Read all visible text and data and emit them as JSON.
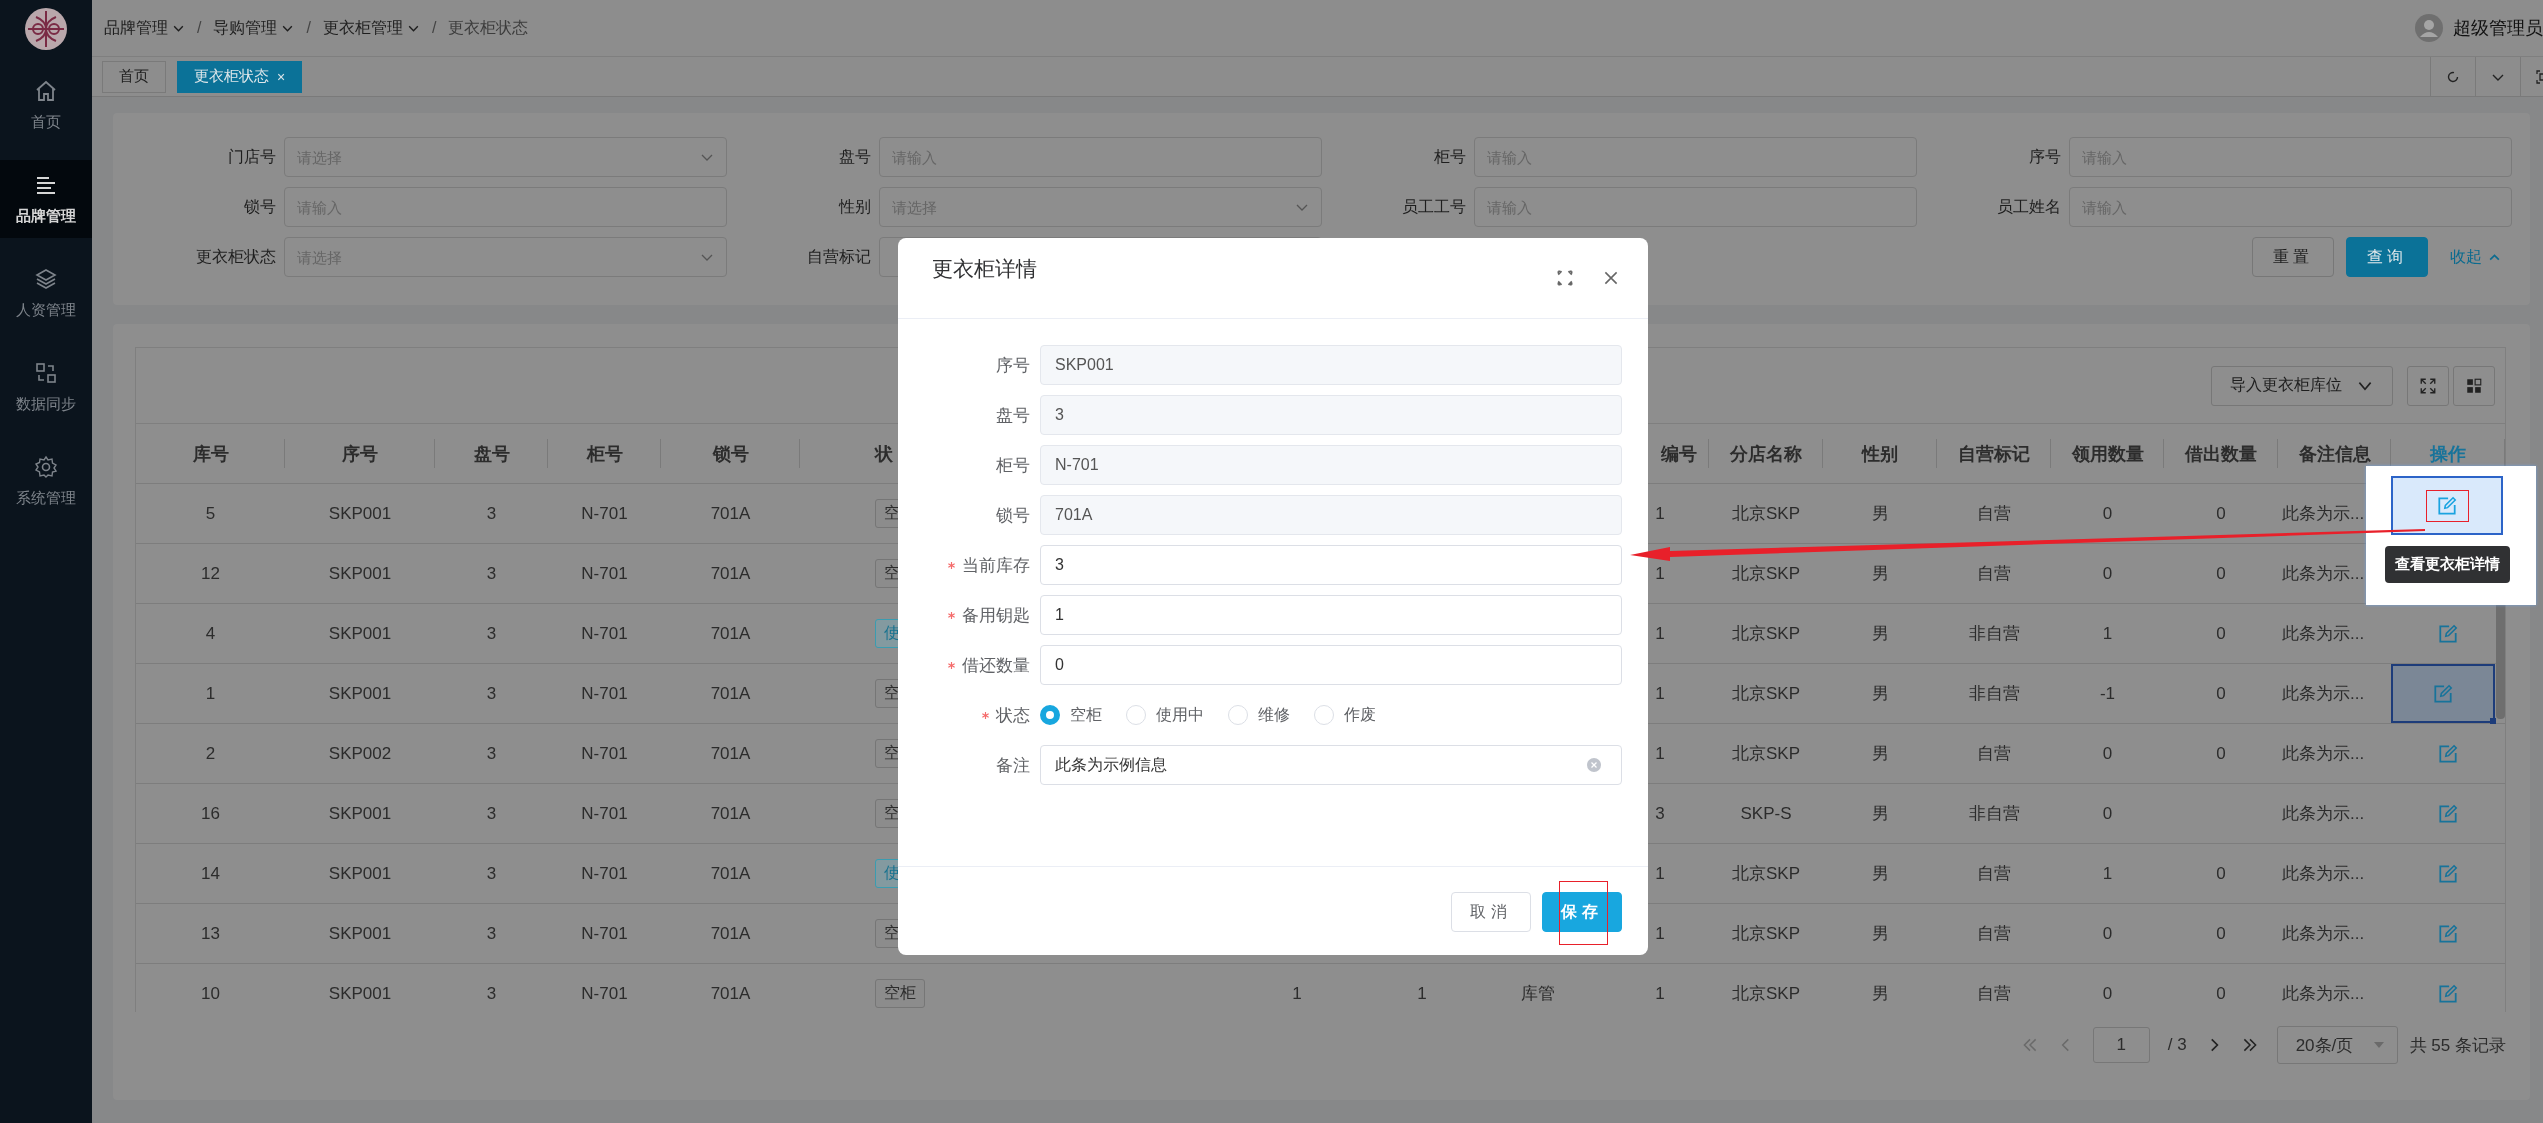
{
  "sidebar": {
    "items": [
      {
        "label": "首页",
        "kind": "home",
        "selected": false
      },
      {
        "label": "品牌管理",
        "kind": "menu",
        "selected": true
      },
      {
        "label": "人资管理",
        "kind": "layers",
        "selected": false
      },
      {
        "label": "数据同步",
        "kind": "sync",
        "selected": false
      },
      {
        "label": "系统管理",
        "kind": "settings",
        "selected": false
      }
    ]
  },
  "header": {
    "breadcrumb": [
      {
        "label": "品牌管理",
        "dropdown": true
      },
      {
        "separator": "/",
        "label": "导购管理",
        "dropdown": true
      },
      {
        "separator": "/",
        "label": "更衣柜管理",
        "dropdown": true
      },
      {
        "separator": "/",
        "label": "更衣柜状态",
        "dropdown": false
      }
    ],
    "user": "超级管理员"
  },
  "tabs": [
    {
      "label": "首页",
      "selected": false
    },
    {
      "label": "更衣柜状态",
      "selected": true,
      "close": "×"
    }
  ],
  "filters": {
    "fields": [
      {
        "label": "门店号",
        "kind": "select",
        "placeholder": "请选择"
      },
      {
        "label": "盘号",
        "kind": "input",
        "placeholder": "请输入"
      },
      {
        "label": "柜号",
        "kind": "input",
        "placeholder": "请输入"
      },
      {
        "label": "序号",
        "kind": "input",
        "placeholder": "请输入"
      },
      {
        "label": "锁号",
        "kind": "input",
        "placeholder": "请输入"
      },
      {
        "label": "性别",
        "kind": "select",
        "placeholder": "请选择"
      },
      {
        "label": "员工工号",
        "kind": "input",
        "placeholder": "请输入"
      },
      {
        "label": "员工姓名",
        "kind": "input",
        "placeholder": "请输入"
      },
      {
        "label": "更衣柜状态",
        "kind": "select",
        "placeholder": "请选择"
      },
      {
        "label": "自营标记",
        "kind": "input"
      }
    ],
    "buttons": [
      {
        "label": "重置",
        "primary": false
      },
      {
        "label": "查询",
        "primary": true
      }
    ],
    "collapse": "收起"
  },
  "table": {
    "toolbar": {
      "import": "导入更衣柜库位"
    },
    "headers": {
      "store_no": "库号",
      "serial": "序号",
      "disk": "盘号",
      "cabinet": "柜号",
      "lock": "锁号",
      "status": "状",
      "column_10": "编号",
      "branch": "分店名称",
      "gender": "性别",
      "self_operated": "自营标记",
      "used_qty": "领用数量",
      "lent_qty": "借出数量",
      "note": "备注信息",
      "action": "操作"
    },
    "rows": [
      {
        "store_no": "5",
        "serial": "SKP001",
        "disk": "3",
        "cabinet": "N-701",
        "lock": "701A",
        "status": {
          "text": "空",
          "kind": "empty"
        },
        "column_10": "1",
        "branch": "北京SKP",
        "gender": "男",
        "self_operated": "自营",
        "used_qty": "0",
        "lent_qty": "0",
        "note": "此条为示...",
        "selected": false
      },
      {
        "store_no": "12",
        "serial": "SKP001",
        "disk": "3",
        "cabinet": "N-701",
        "lock": "701A",
        "status": {
          "text": "空",
          "kind": "empty"
        },
        "column_10": "1",
        "branch": "北京SKP",
        "gender": "男",
        "self_operated": "自营",
        "used_qty": "0",
        "lent_qty": "0",
        "note": "此条为示...",
        "selected": false
      },
      {
        "store_no": "4",
        "action_icon": true,
        "serial": "SKP001",
        "disk": "3",
        "cabinet": "N-701",
        "lock": "701A",
        "status": {
          "text": "使",
          "kind": "in_use"
        },
        "column_10": "1",
        "branch": "北京SKP",
        "gender": "男",
        "self_operated": "非自营",
        "used_qty": "1",
        "lent_qty": "0",
        "note": "此条为示...",
        "selected": false
      },
      {
        "store_no": "1",
        "action_icon": true,
        "serial": "SKP001",
        "disk": "3",
        "cabinet": "N-701",
        "lock": "701A",
        "status": {
          "text": "空",
          "kind": "empty"
        },
        "column_10": "1",
        "branch": "北京SKP",
        "gender": "男",
        "self_operated": "非自营",
        "used_qty": "-1",
        "lent_qty": "0",
        "note": "此条为示...",
        "selected": true
      },
      {
        "store_no": "2",
        "action_icon": true,
        "serial": "SKP002",
        "disk": "3",
        "cabinet": "N-701",
        "lock": "701A",
        "status": {
          "text": "空",
          "kind": "empty"
        },
        "column_10": "1",
        "branch": "北京SKP",
        "gender": "男",
        "self_operated": "自营",
        "used_qty": "0",
        "lent_qty": "0",
        "note": "此条为示...",
        "selected": false
      },
      {
        "store_no": "16",
        "action_icon": true,
        "serial": "SKP001",
        "disk": "3",
        "cabinet": "N-701",
        "lock": "701A",
        "status": {
          "text": "空",
          "kind": "empty"
        },
        "column_10": "3",
        "branch": "SKP-S",
        "gender": "男",
        "self_operated": "非自营",
        "used_qty": "0",
        "note": "此条为示...",
        "selected": false
      },
      {
        "store_no": "14",
        "action_icon": true,
        "serial": "SKP001",
        "disk": "3",
        "cabinet": "N-701",
        "lock": "701A",
        "status": {
          "text": "使",
          "kind": "in_use"
        },
        "column_10": "1",
        "branch": "北京SKP",
        "gender": "男",
        "self_operated": "自营",
        "used_qty": "1",
        "lent_qty": "0",
        "note": "此条为示...",
        "selected": false
      },
      {
        "store_no": "13",
        "action_icon": true,
        "serial": "SKP001",
        "disk": "3",
        "cabinet": "N-701",
        "lock": "701A",
        "status": {
          "text": "空",
          "kind": "empty"
        },
        "column_10": "1",
        "branch": "北京SKP",
        "gender": "男",
        "self_operated": "自营",
        "used_qty": "0",
        "lent_qty": "0",
        "note": "此条为示...",
        "selected": false
      },
      {
        "store_no": "10",
        "action_icon": true,
        "serial": "SKP001",
        "disk": "3",
        "cabinet": "N-701",
        "lock": "701A",
        "status": {
          "text": "空柜",
          "kind": "empty"
        },
        "column_7": "1",
        "column_8": "1",
        "column_9": "库管",
        "column_10": "1",
        "branch": "北京SKP",
        "gender": "男",
        "self_operated": "自营",
        "used_qty": "0",
        "lent_qty": "0",
        "note": "此条为示...",
        "selected": false
      }
    ],
    "pagination": {
      "page": "1",
      "pages": "/ 3",
      "page_size": "20条/页",
      "total": "共 55 条记录"
    }
  },
  "modal": {
    "title": "更衣柜详情",
    "fields": [
      {
        "label": "序号",
        "required": false,
        "value": "SKP001",
        "disabled": true
      },
      {
        "label": "盘号",
        "required": false,
        "value": "3",
        "disabled": true
      },
      {
        "label": "柜号",
        "required": false,
        "value": "N-701",
        "disabled": true
      },
      {
        "label": "锁号",
        "required": false,
        "value": "701A",
        "disabled": true
      },
      {
        "label": "当前库存",
        "required": true,
        "value": "3",
        "disabled": false
      },
      {
        "label": "备用钥匙",
        "required": true,
        "value": "1",
        "disabled": false
      },
      {
        "label": "借还数量",
        "required": true,
        "value": "0",
        "disabled": false
      }
    ],
    "status": {
      "label": "状态",
      "required": true,
      "options": [
        {
          "label": "空柜",
          "selected": true
        },
        {
          "label": "使用中",
          "selected": false
        },
        {
          "label": "维修",
          "selected": false
        },
        {
          "label": "作废",
          "selected": false
        }
      ]
    },
    "remark": {
      "label": "备注",
      "value": "此条为示例信息"
    },
    "buttons": [
      {
        "label": "取消",
        "primary": false
      },
      {
        "label": "保存",
        "primary": true
      }
    ]
  },
  "annotation": {
    "tooltip": "查看更衣柜详情"
  }
}
